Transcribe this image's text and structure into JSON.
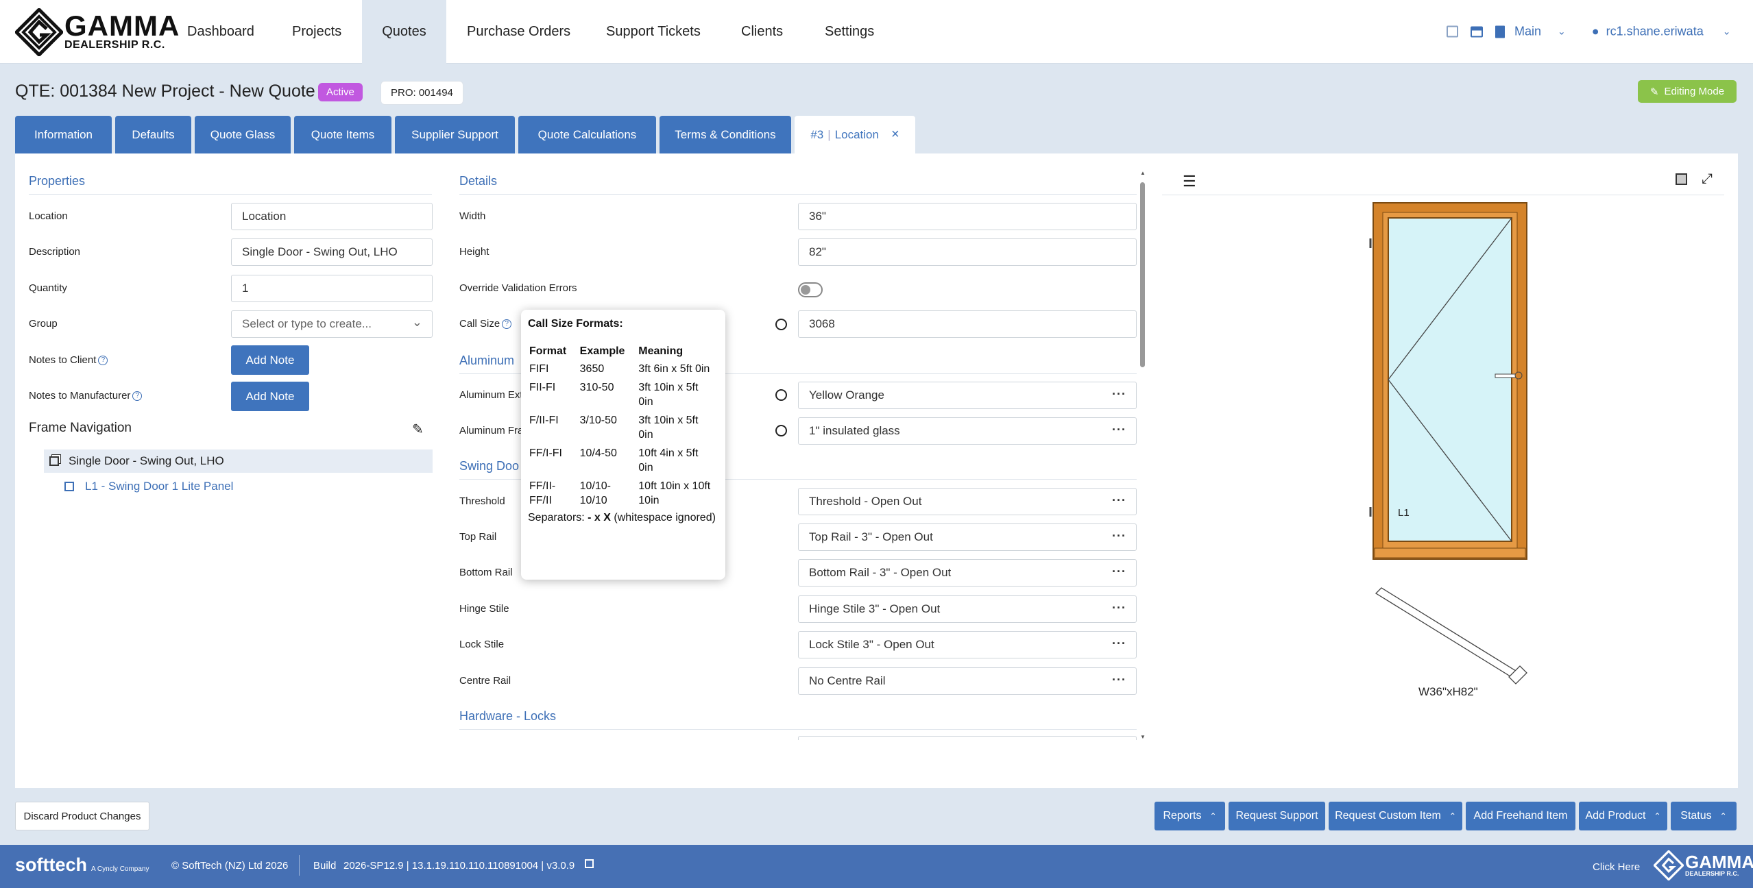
{
  "brand": {
    "name": "GAMMA",
    "sub": "DEALERSHIP R.C."
  },
  "nav": [
    "Dashboard",
    "Projects",
    "Quotes",
    "Purchase Orders",
    "Support Tickets",
    "Clients",
    "Settings"
  ],
  "header_right": {
    "branch": "Main",
    "user": "rc1.shane.eriwata"
  },
  "quote": {
    "title": "QTE: 001384 New Project - New Quote",
    "status": "Active",
    "project_ref": "PRO: 001494",
    "mode": "Editing Mode"
  },
  "tabs": [
    "Information",
    "Defaults",
    "Quote Glass",
    "Quote Items",
    "Supplier Support",
    "Quote Calculations",
    "Terms & Conditions"
  ],
  "active_tab": {
    "num": "#3",
    "label": "Location"
  },
  "properties": {
    "heading": "Properties",
    "fields": [
      {
        "label": "Location",
        "value": "Location"
      },
      {
        "label": "Description",
        "value": "Single Door - Swing Out, LHO"
      },
      {
        "label": "Quantity",
        "value": "1"
      },
      {
        "label": "Group",
        "placeholder": "Select or type to create..."
      }
    ],
    "notes_client": "Notes to Client",
    "notes_manufacturer": "Notes to Manufacturer",
    "add_note": "Add Note"
  },
  "frame_nav": {
    "heading": "Frame Navigation",
    "items": [
      "Single Door - Swing Out, LHO",
      "L1 - Swing Door 1 Lite Panel"
    ]
  },
  "details": {
    "heading": "Details",
    "width_label": "Width",
    "width": "36\"",
    "height_label": "Height",
    "height": "82\"",
    "override_label": "Override Validation Errors",
    "callsize_label": "Call Size",
    "callsize": "3068",
    "aluminum_heading": "Aluminum",
    "al_ext_label": "Aluminum Ext",
    "al_ext": "Yellow Orange",
    "al_fra_label": "Aluminum Fra",
    "al_fra": "1\" insulated glass",
    "swing_heading": "Swing Doo",
    "rows": [
      {
        "label": "Threshold",
        "value": "Threshold - Open Out"
      },
      {
        "label": "Top Rail",
        "value": "Top Rail - 3\" - Open Out"
      },
      {
        "label": "Bottom Rail",
        "value": "Bottom Rail - 3\" - Open Out"
      },
      {
        "label": "Hinge Stile",
        "value": "Hinge Stile 3\" - Open Out"
      },
      {
        "label": "Lock Stile",
        "value": "Lock Stile 3\" - Open Out"
      },
      {
        "label": "Centre Rail",
        "value": "No Centre Rail"
      }
    ],
    "hardware_heading": "Hardware - Locks"
  },
  "tooltip": {
    "title": "Call Size Formats:",
    "headers": [
      "Format",
      "Example",
      "Meaning"
    ],
    "rows": [
      [
        "FIFI",
        "3650",
        "3ft 6in x 5ft 0in"
      ],
      [
        "FII-FI",
        "310-50",
        "3ft 10in x 5ft 0in"
      ],
      [
        "F/II-FI",
        "3/10-50",
        "3ft 10in x 5ft 0in"
      ],
      [
        "FF/I-FI",
        "10/4-50",
        "10ft 4in x 5ft 0in"
      ],
      [
        "FF/II-FF/II",
        "10/10-10/10",
        "10ft 10in x 10ft 10in"
      ]
    ],
    "sep_prefix": "Separators: ",
    "sep_chars": "- x X",
    "sep_suffix": " (whitespace ignored)"
  },
  "preview": {
    "panel_label": "L1",
    "dimensions": "W36\"xH82\""
  },
  "bottom": {
    "discard": "Discard Product Changes",
    "buttons": [
      "Reports",
      "Request Support",
      "Request Custom Item",
      "Add Freehand Item",
      "Add Product",
      "Status"
    ]
  },
  "footer": {
    "brand": "softtech",
    "sub": "A Cyncly Company",
    "copyright": "© SoftTech (NZ) Ltd 2026",
    "build_label": "Build",
    "build": "2026-SP12.9 | 13.1.19.110.110.110891004 | v3.0.9",
    "click": "Click Here"
  },
  "colors": {
    "accent": "#3f74bd",
    "active_badge": "#c158e0",
    "editing": "#8bc34a",
    "frame": "#d4832a",
    "glass": "#d6f3f8"
  }
}
